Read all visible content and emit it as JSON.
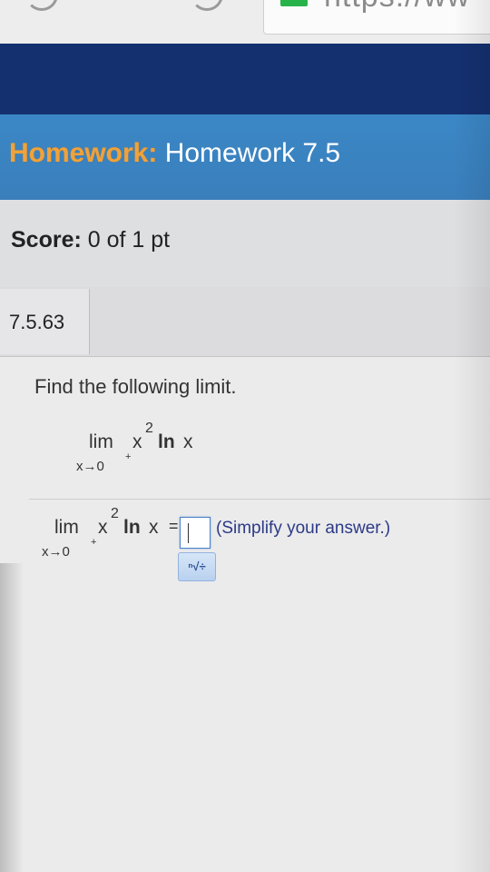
{
  "browser": {
    "url_fragment": "https://ww"
  },
  "header": {
    "title_label": "Homework:",
    "title_value": "Homework 7.5"
  },
  "score": {
    "label": "Score:",
    "value": "0 of 1 pt"
  },
  "question": {
    "number": "7.5.63",
    "prompt": "Find the following limit.",
    "expression": {
      "lim": "lim",
      "base": "x",
      "exponent": "2",
      "func": "ln",
      "var": "x",
      "approach": "x→0",
      "approach_sign": "+"
    },
    "answer_row": {
      "equals": "=",
      "answer_value": "",
      "hint": "(Simplify your answer.)",
      "math_palette_label": "ⁿ√÷"
    }
  },
  "colors": {
    "nav_band": "#14306f",
    "title_bar": "#3b87c6",
    "title_label": "#f0a23a",
    "hint_text": "#2c3a86"
  }
}
